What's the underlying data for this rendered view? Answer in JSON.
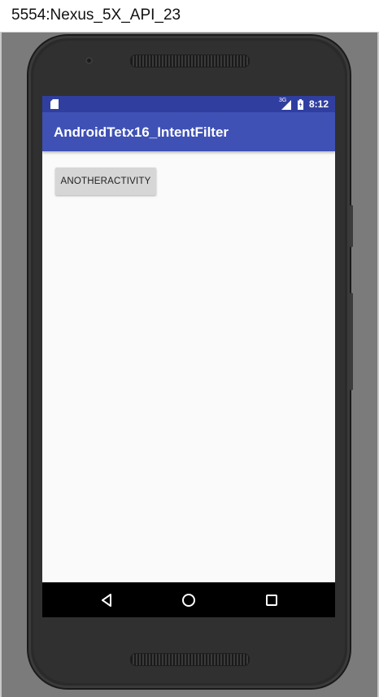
{
  "window": {
    "title": "5554:Nexus_5X_API_23"
  },
  "status_bar": {
    "network_type": "3G",
    "time": "8:12",
    "icons": [
      "sd-card-icon",
      "signal-icon",
      "battery-icon"
    ]
  },
  "app_bar": {
    "title": "AndroidTetx16_IntentFilter"
  },
  "content": {
    "button_label": "ANOTHERACTIVITY"
  },
  "nav_bar": {
    "buttons": [
      "back-icon",
      "home-icon",
      "recents-icon"
    ]
  },
  "colors": {
    "status_bar": "#303f9f",
    "app_bar": "#3f51b5",
    "screen_background": "#fafafa",
    "button_background": "#d6d6d6"
  }
}
